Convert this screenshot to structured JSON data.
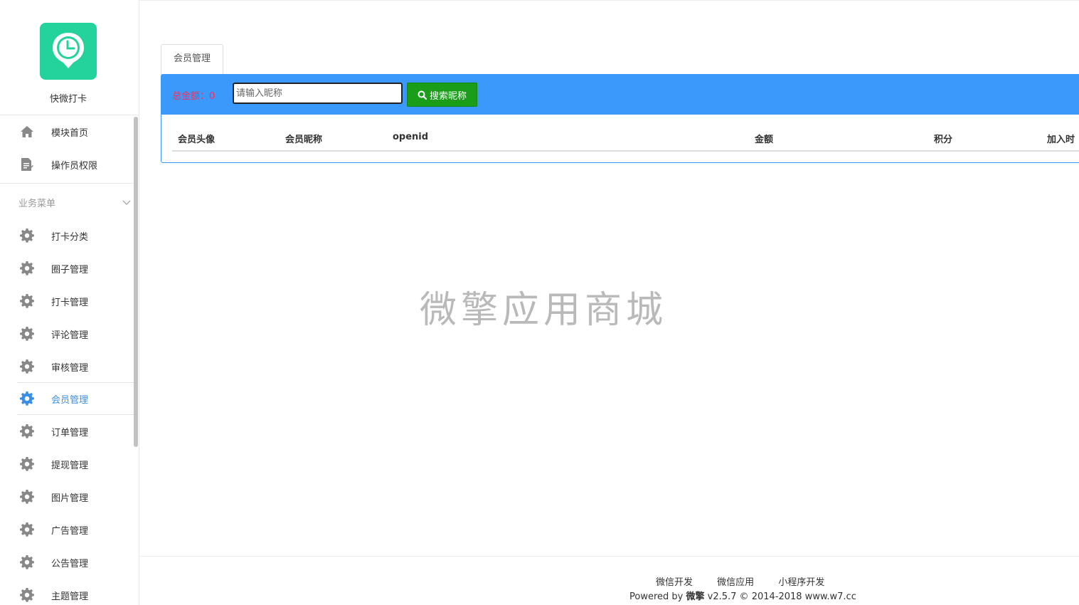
{
  "app": {
    "name": "快微打卡",
    "brand_color": "#24d29b"
  },
  "sidebar": {
    "top_items": [
      {
        "label": "模块首页",
        "icon": "home-icon"
      },
      {
        "label": "操作员权限",
        "icon": "document-edit-icon"
      }
    ],
    "section_title": "业务菜单",
    "items": [
      {
        "label": "打卡分类",
        "icon": "gear-icon"
      },
      {
        "label": "圈子管理",
        "icon": "gear-icon"
      },
      {
        "label": "打卡管理",
        "icon": "gear-icon"
      },
      {
        "label": "评论管理",
        "icon": "gear-icon"
      },
      {
        "label": "审核管理",
        "icon": "gear-icon"
      },
      {
        "label": "会员管理",
        "icon": "gear-icon",
        "active": true
      },
      {
        "label": "订单管理",
        "icon": "gear-icon"
      },
      {
        "label": "提现管理",
        "icon": "gear-icon"
      },
      {
        "label": "图片管理",
        "icon": "gear-icon"
      },
      {
        "label": "广告管理",
        "icon": "gear-icon"
      },
      {
        "label": "公告管理",
        "icon": "gear-icon"
      },
      {
        "label": "主题管理",
        "icon": "gear-icon"
      }
    ],
    "active_color": "#3a8ee6"
  },
  "main": {
    "tab_label": "会员管理",
    "total_label": "总金额：0",
    "search": {
      "placeholder": "请输入昵称",
      "button_label": "搜索昵称"
    },
    "table": {
      "columns": [
        "会员头像",
        "会员昵称",
        "openid",
        "金额",
        "积分",
        "加入时"
      ]
    },
    "accent_color": "#3a99fa"
  },
  "watermark": "微擎应用商城",
  "footer": {
    "links": [
      "微信开发",
      "微信应用",
      "小程序开发"
    ],
    "powered_prefix": "Powered by",
    "powered_brand": "微擎",
    "powered_suffix": "v2.5.7 © 2014-2018 www.w7.cc"
  }
}
